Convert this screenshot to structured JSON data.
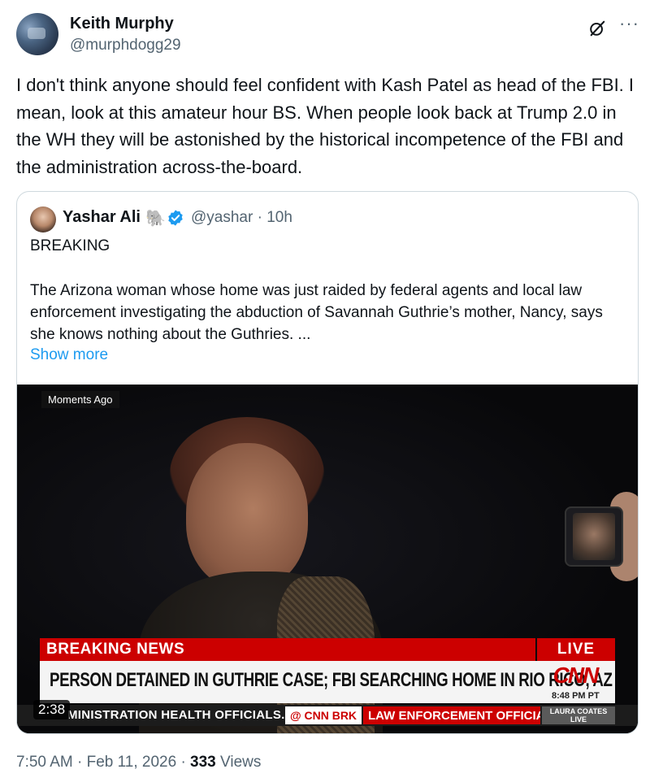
{
  "post": {
    "author_name": "Keith Murphy",
    "author_handle": "@murphdogg29",
    "text": "I don't think anyone should feel confident with Kash Patel as head of the FBI. I mean, look at this amateur hour BS. When people look back at Trump 2.0 in the WH they will be astonished by the historical incompetence of the FBI and the administration across-the-board.",
    "icons": {
      "grok": "grok-icon",
      "more": "more-icon"
    },
    "more_glyph": "···"
  },
  "quote": {
    "author_name": "Yashar Ali",
    "elephant_glyph": "🐘",
    "handle_time": "@yashar · 10h",
    "headline": "BREAKING",
    "body": "The Arizona woman whose home was just raided by federal agents and local law enforcement investigating the abduction of Savannah Guthrie’s mother, Nancy, says she knows nothing about the Guthries. ...",
    "show_more": "Show more"
  },
  "video": {
    "moments_ago": "Moments Ago",
    "breaking_news": "BREAKING NEWS",
    "live": "LIVE",
    "headline": "PERSON DETAINED IN GUTHRIE CASE; FBI SEARCHING HOME IN RIO RICO, AZ",
    "network_logo": "CNN",
    "time": "8:48 PM PT",
    "ticker_left": "MINISTRATION HEALTH OFFICIALS.",
    "ticker_brk": "@ CNN BRK",
    "ticker_right": "LAW ENFORCEMENT OFFICIAL",
    "anchor_tag_line1": "LAURA COATES",
    "anchor_tag_line2": "LIVE",
    "duration": "2:38"
  },
  "footer": {
    "time_date": "7:50 AM · Feb 11, 2026 · ",
    "views_count": "333",
    "views_label": " Views"
  },
  "colors": {
    "accent": "#1d9bf0",
    "cnn_red": "#cc0000",
    "muted": "#536471"
  }
}
